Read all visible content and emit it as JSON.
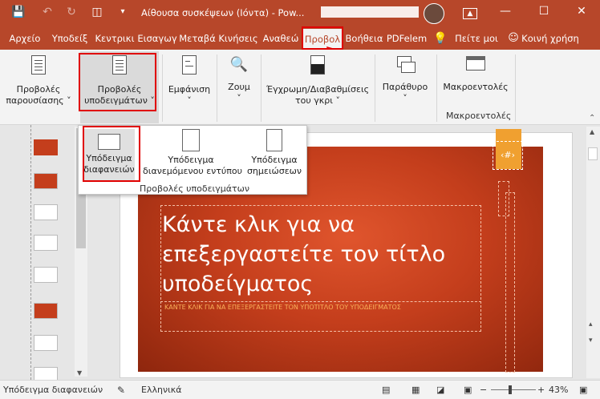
{
  "window": {
    "title": "Αίθουσα συσκέψεων (Ιόντα) - Pow...",
    "user_avatar": "avatar",
    "controls": [
      "ribbon-display",
      "minimize",
      "maximize",
      "close"
    ]
  },
  "quick_access": [
    "save-icon",
    "undo-icon",
    "redo-icon",
    "present-icon",
    "customize-icon"
  ],
  "tabs": [
    {
      "label": "Αρχείο"
    },
    {
      "label": "Υποδείξ"
    },
    {
      "label": "Κεντρικι"
    },
    {
      "label": "Εισαγωγ"
    },
    {
      "label": "Μεταβά"
    },
    {
      "label": "Κινήσεις"
    },
    {
      "label": "Αναθεώ"
    },
    {
      "label": "Προβολ",
      "active": true
    },
    {
      "label": "Βοήθεια"
    },
    {
      "label": "PDFelem"
    }
  ],
  "tellme": "Πείτε μοι",
  "share": "Κοινή χρήση",
  "ribbon": {
    "presentation_views": {
      "line1": "Προβολές",
      "line2": "παρουσίασης ˅"
    },
    "master_views": {
      "line1": "Προβολές",
      "line2": "υποδειγμάτων ˅"
    },
    "show": "Εμφάνιση",
    "zoom": "Ζουμ",
    "color": {
      "line1": "Έγχρωμη/Διαβαθμίσεις",
      "line2": "του γκρι ˅"
    },
    "window": "Παράθυρο",
    "macros": "Μακροεντολές",
    "macros_group": "Μακροεντολές"
  },
  "dropdown": {
    "items": [
      {
        "line1": "Υπόδειγμα",
        "line2": "διαφανειών"
      },
      {
        "line1": "Υπόδειγμα",
        "line2": "διανεμόμενου εντύπου"
      },
      {
        "line1": "Υπόδειγμα",
        "line2": "σημειώσεων"
      }
    ],
    "group_label": "Προβολές υποδειγμάτων"
  },
  "slide": {
    "title": "Κάντε κλικ για να επεξεργαστείτε τον τίτλο υποδείγματος",
    "subtitle": "ΚΑΝΤΕ ΚΛΙΚ ΓΙΑ ΝΑ ΕΠΕΞΕΡΓΑΣΤΕΙΤΕ ΤΟΝ ΥΠΟΤΙΤΛΟ ΤΟΥ ΥΠΟΔΕΙΓΜΑΤΟΣ",
    "number_placeholder": "‹#›"
  },
  "status": {
    "view": "Υπόδειγμα διαφανειών",
    "language": "Ελληνικά",
    "zoom": "43%"
  },
  "colors": {
    "accent": "#b7472a",
    "slide": "#c43e1c",
    "highlight": "#e00000",
    "badge": "#f0a030"
  }
}
